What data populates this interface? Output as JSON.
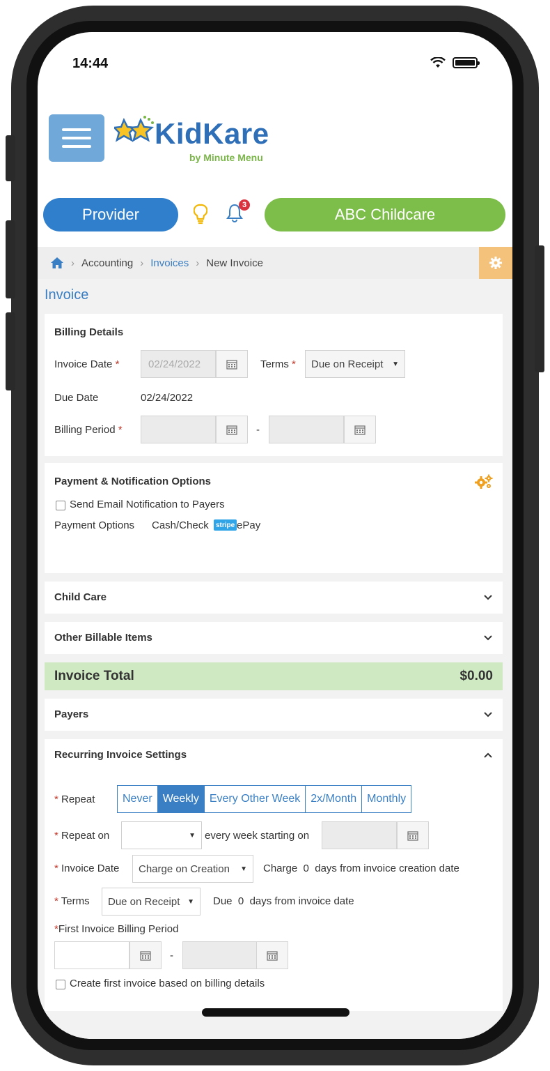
{
  "status_bar": {
    "time": "14:44"
  },
  "header": {
    "logo_text": "KidKare",
    "logo_sub": "by Minute Menu",
    "provider_label": "Provider",
    "notification_count": "3",
    "center_name": "ABC Childcare"
  },
  "breadcrumb": {
    "item1": "Accounting",
    "item2": "Invoices",
    "item3": "New Invoice"
  },
  "page_title": "Invoice",
  "billing": {
    "title": "Billing Details",
    "invoice_date_label": "Invoice Date",
    "invoice_date_value": "02/24/2022",
    "terms_label": "Terms",
    "terms_value": "Due on Receipt",
    "due_date_label": "Due Date",
    "due_date_value": "02/24/2022",
    "billing_period_label": "Billing Period",
    "dash": "-"
  },
  "payment": {
    "title": "Payment & Notification Options",
    "send_email_label": "Send Email Notification to Payers",
    "options_label": "Payment Options",
    "option_cash": "Cash/Check",
    "stripe_badge": "stripe",
    "option_epay": "ePay"
  },
  "sections": {
    "child_care": "Child Care",
    "other_billable": "Other Billable Items",
    "payers": "Payers",
    "recurring": "Recurring Invoice Settings"
  },
  "total": {
    "label": "Invoice Total",
    "value": "$0.00"
  },
  "recurring": {
    "repeat_label": "Repeat",
    "repeat_options": [
      "Never",
      "Weekly",
      "Every Other Week",
      "2x/Month",
      "Monthly"
    ],
    "repeat_selected": "Weekly",
    "repeat_on_label": "Repeat on",
    "every_week_label": "every week starting on",
    "invoice_date_label": "Invoice Date",
    "invoice_date_value": "Charge on Creation",
    "charge_text": "Charge",
    "charge_days": "0",
    "charge_suffix": "days from invoice creation date",
    "terms_label": "Terms",
    "terms_value": "Due on Receipt",
    "due_text": "Due",
    "due_days": "0",
    "due_suffix": "days from invoice date",
    "first_period_label": "First Invoice Billing Period",
    "dash": "-",
    "create_first_label": "Create first invoice based on billing details"
  },
  "colors": {
    "primary_blue": "#3a7fc4",
    "provider_blue": "#2f7fcc",
    "center_green": "#7dbd4a",
    "total_green": "#cfeac2",
    "required_red": "#c0392b",
    "gear_orange": "#f4c27a"
  }
}
